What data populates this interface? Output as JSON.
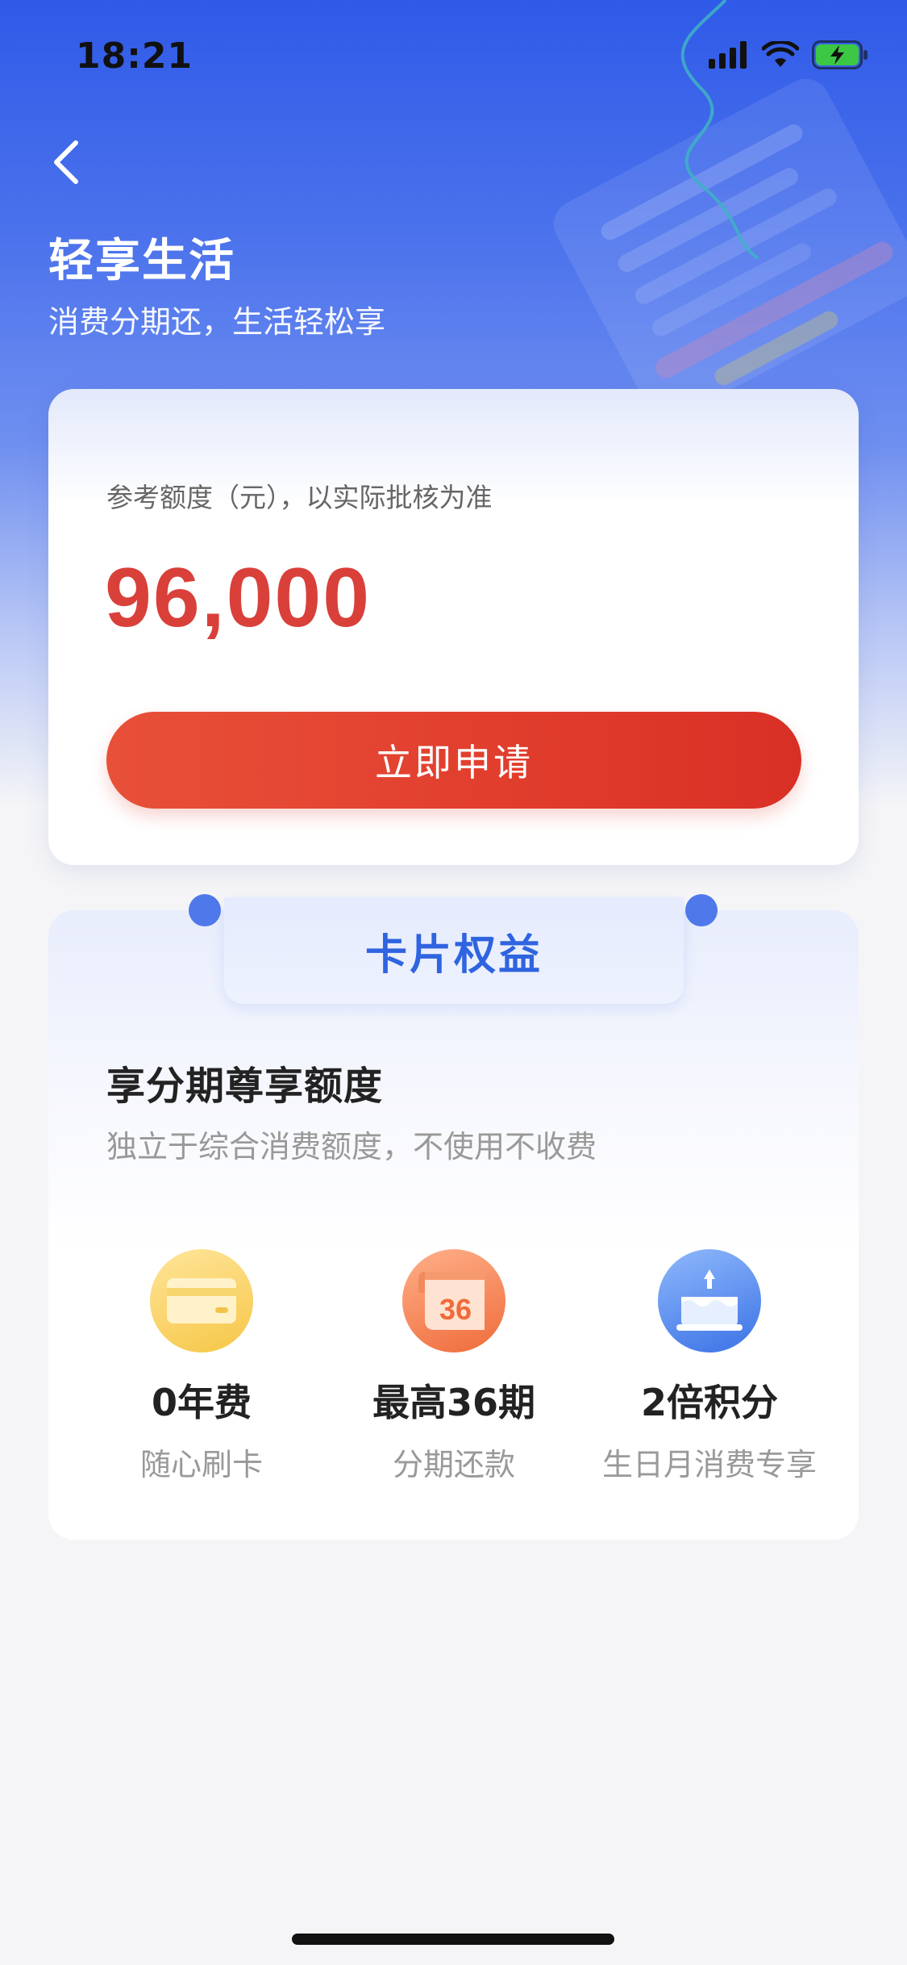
{
  "status_bar": {
    "time": "18:21",
    "signal_icon": "cellular-signal-icon",
    "wifi_icon": "wifi-icon",
    "battery_icon": "battery-charging-icon"
  },
  "header": {
    "back_icon": "chevron-left-icon",
    "title": "轻享生活",
    "subtitle": "消费分期还，生活轻松享"
  },
  "limit_card": {
    "label": "参考额度（元），以实际批核为准",
    "amount": "96,000",
    "apply_label": "立即申请"
  },
  "benefits": {
    "tab_label": "卡片权益",
    "heading": "享分期尊享额度",
    "description": "独立于综合消费额度，不使用不收费",
    "features": [
      {
        "icon": "credit-card-icon",
        "title": "0年费",
        "subtitle": "随心刷卡"
      },
      {
        "icon": "calendar-icon",
        "badge": "36",
        "title": "最高36期",
        "subtitle": "分期还款"
      },
      {
        "icon": "birthday-cake-icon",
        "title": "2倍积分",
        "subtitle": "生日月消费专享"
      }
    ]
  },
  "colors": {
    "brand_blue": "#2f5ae8",
    "accent_red": "#d9403a",
    "tab_blue": "#2f64e0"
  }
}
